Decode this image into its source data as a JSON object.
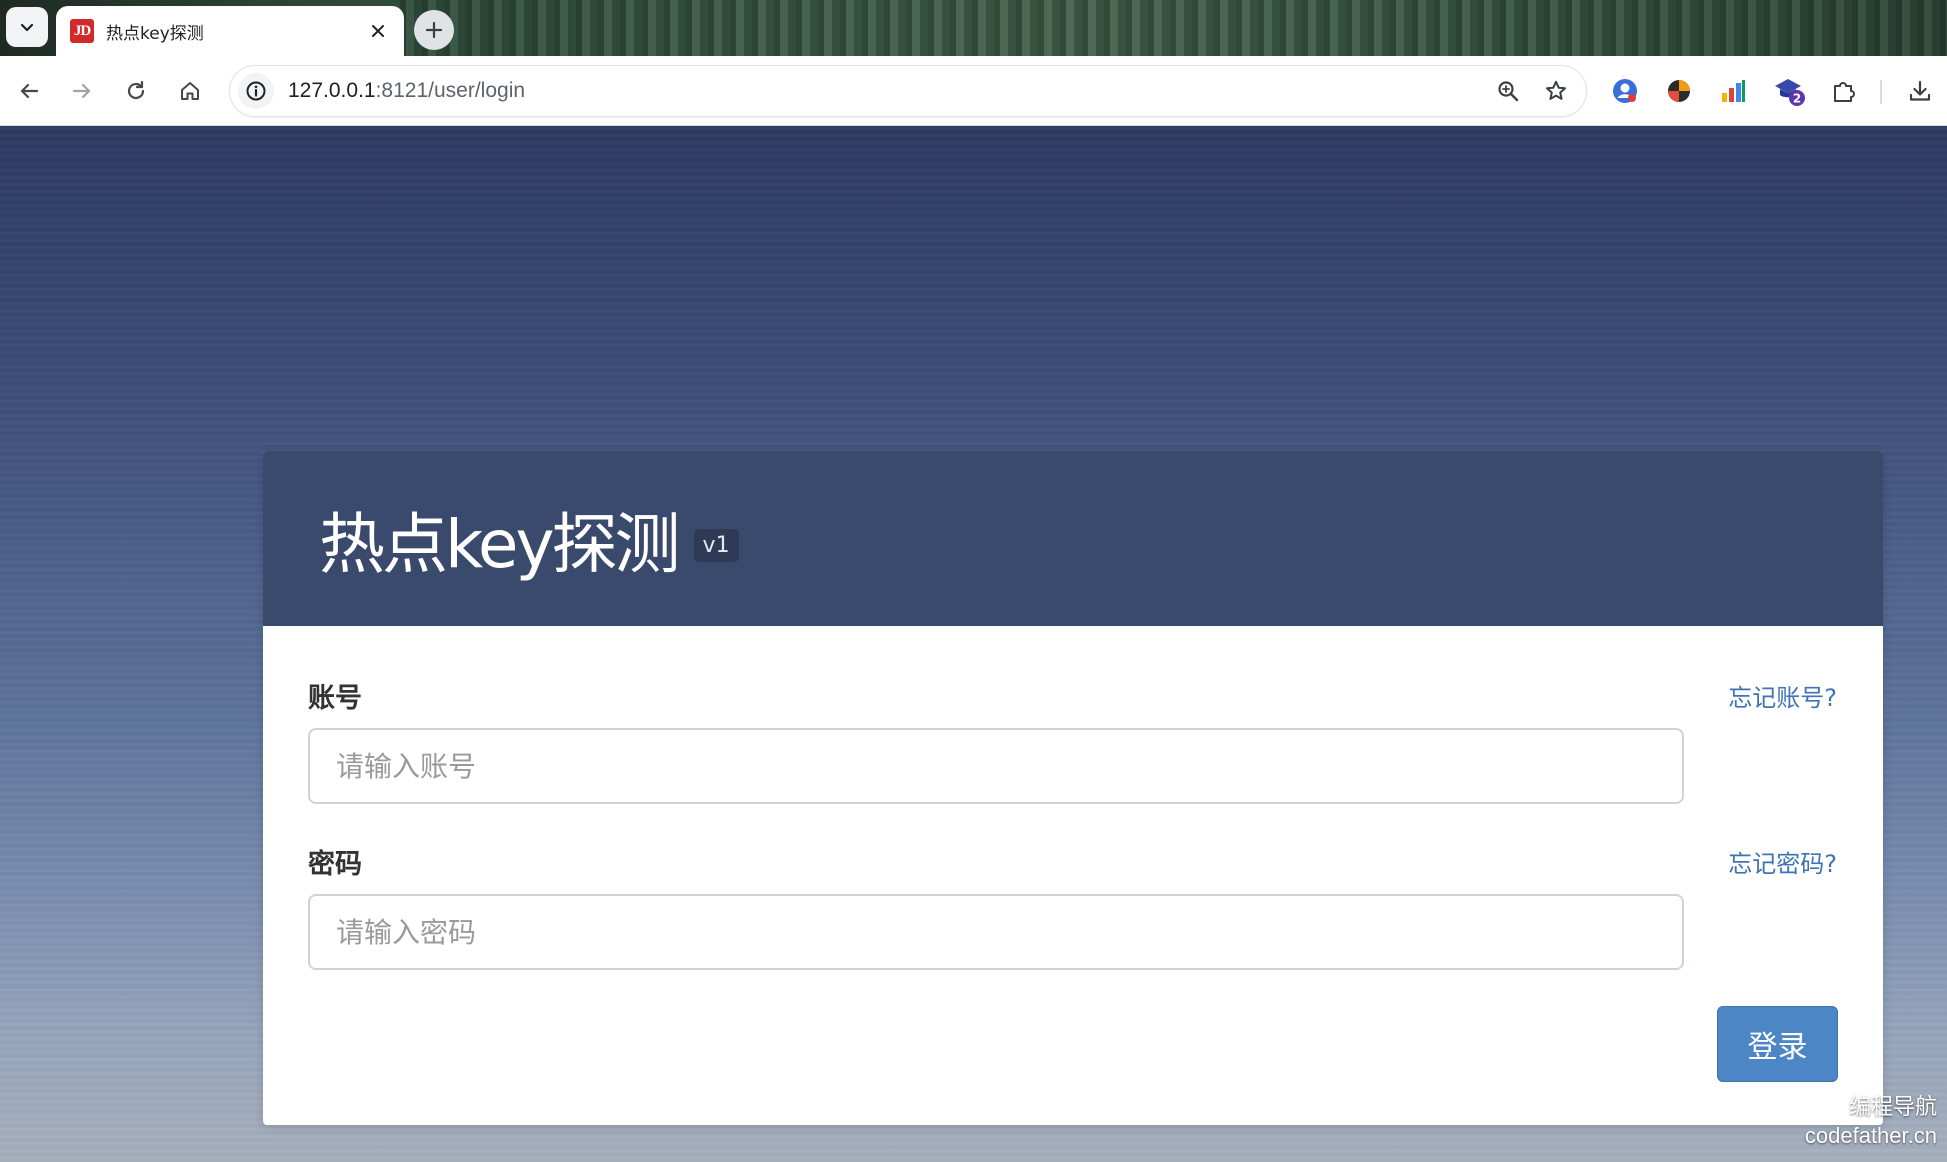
{
  "browser": {
    "tab": {
      "title": "热点key探测",
      "favicon_text": "JD"
    },
    "address_bar": {
      "url_host": "127.0.0.1",
      "url_rest": ":8121/user/login"
    },
    "icons": {
      "tab_search": "chevron-down-icon",
      "close": "close-icon",
      "new_tab": "plus-icon",
      "back": "arrow-left-icon",
      "forward": "arrow-right-icon",
      "reload": "reload-icon",
      "home": "home-icon",
      "site_info": "info-icon",
      "zoom": "zoom-icon",
      "bookmark": "star-icon",
      "extensions": "puzzle-icon",
      "download": "download-icon"
    },
    "extension_badge": "2"
  },
  "login": {
    "title": "热点key探测",
    "version": "v1",
    "account": {
      "label": "账号",
      "forgot": "忘记账号?",
      "placeholder": "请输入账号",
      "value": ""
    },
    "password": {
      "label": "密码",
      "forgot": "忘记密码?",
      "placeholder": "请输入密码",
      "value": ""
    },
    "submit_label": "登录"
  },
  "watermark": {
    "line1": "编程导航",
    "line2": "codefather.cn"
  },
  "colors": {
    "header_bg": "#3a4a6d",
    "button_bg": "#4d86c5",
    "link": "#3f73b3"
  }
}
